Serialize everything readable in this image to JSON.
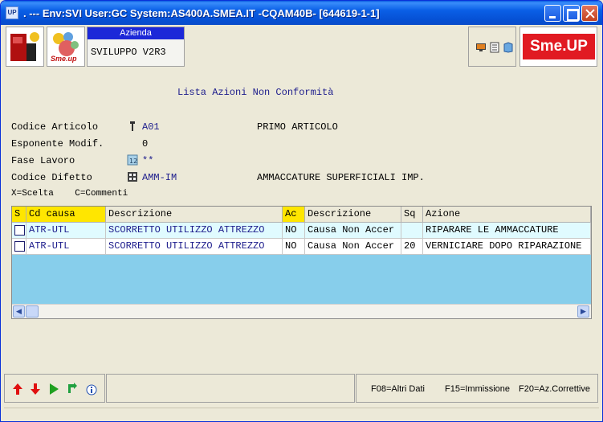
{
  "window": {
    "title": ". --- Env:SVI User:GC System:AS400A.SMEA.IT -CQAM40B- [644619-1-1]",
    "icon_text": "UP",
    "accent": "#0a5fe6"
  },
  "header": {
    "azienda_label": "Azienda",
    "azienda_value": "SVILUPPO V2R3",
    "brand_logo": "Sme.UP",
    "small_logo_text": "Sme.up"
  },
  "form": {
    "title": "Lista Azioni Non Conformità",
    "fields": [
      {
        "label": "Codice Articolo",
        "icon": "pin-icon",
        "value": "A01",
        "desc": "PRIMO ARTICOLO"
      },
      {
        "label": "Esponente Modif.",
        "icon": "",
        "value": "0",
        "desc": ""
      },
      {
        "label": "Fase Lavoro",
        "icon": "phase-icon",
        "value": "**",
        "desc": ""
      },
      {
        "label": "Codice Difetto",
        "icon": "grid-icon",
        "value": "AMM-IM",
        "desc": "AMMACCATURE SUPERFICIALI IMP."
      }
    ],
    "legend": "X=Scelta    C=Commenti"
  },
  "table": {
    "columns": [
      "S",
      "Cd causa",
      "Descrizione",
      "Ac",
      "Descrizione",
      "Sq",
      "Azione"
    ],
    "rows": [
      {
        "s": "",
        "cd_causa": "ATR-UTL",
        "descrizione": "SCORRETTO UTILIZZO ATTREZZO",
        "ac": "NO",
        "descrizione2": "Causa Non Accer",
        "sq": "",
        "azione": "RIPARARE LE AMMACCATURE"
      },
      {
        "s": "",
        "cd_causa": "ATR-UTL",
        "descrizione": "SCORRETTO UTILIZZO ATTREZZO",
        "ac": "NO",
        "descrizione2": "Causa Non Accer",
        "sq": "20",
        "azione": "VERNICIARE DOPO RIPARAZIONE"
      }
    ],
    "row_color_selected": "#e0fbff",
    "background": "#87ceeb"
  },
  "statusbar": {
    "nav_icons": [
      "arrow-up-icon",
      "arrow-down-icon",
      "play-icon",
      "refresh-icon",
      "info-icon"
    ],
    "fkeys": [
      "F08=Altri Dati",
      "F15=Immissione",
      "F20=Az.Correttive"
    ]
  }
}
